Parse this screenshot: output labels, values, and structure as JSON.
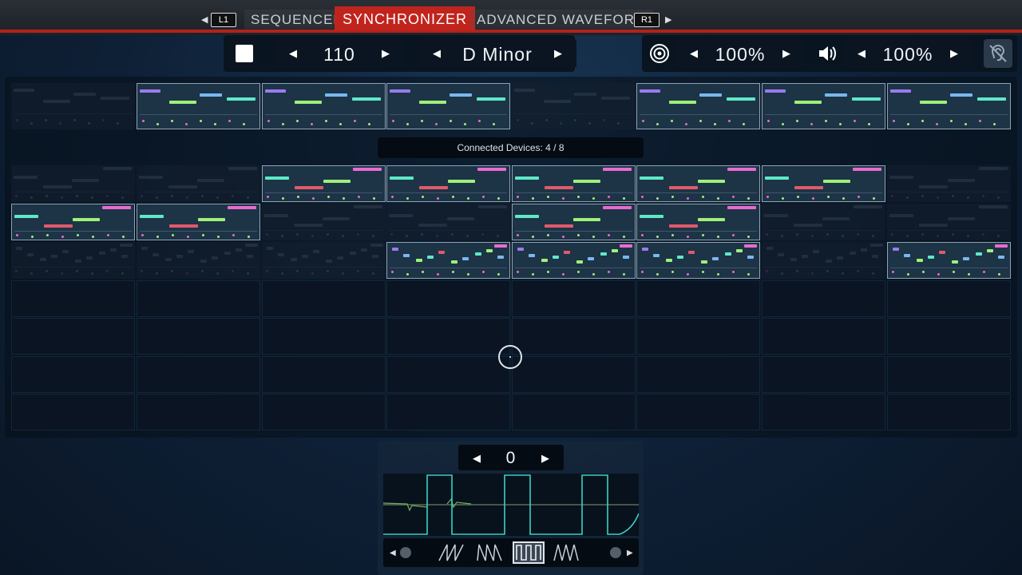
{
  "tabs": {
    "left_key": "L1",
    "right_key": "R1",
    "items": [
      {
        "label": "SEQUENCER",
        "active": false
      },
      {
        "label": "SYNCHRONIZER",
        "active": true
      },
      {
        "label": "ADVANCED WAVEFORM",
        "active": false
      }
    ]
  },
  "toolbar": {
    "tempo": "110",
    "key": "D Minor",
    "target_volume": "100%",
    "master_volume": "100%"
  },
  "status": {
    "connected_devices": "Connected Devices: 4 / 8"
  },
  "waveform": {
    "offset_value": "0",
    "selected_shape": "square-wave",
    "shapes": [
      "sawtooth-wave",
      "ramp-wave",
      "square-wave",
      "triangle-wave"
    ]
  },
  "colors": {
    "accent": "#c1241d",
    "note_purple": "#9b7bf0",
    "note_green": "#9ef07a",
    "note_teal": "#5fe8c6",
    "note_blue": "#7ab8f0",
    "note_pink": "#e86bd0",
    "note_red": "#e05a6a",
    "waveform_line": "#3ad0c6"
  }
}
